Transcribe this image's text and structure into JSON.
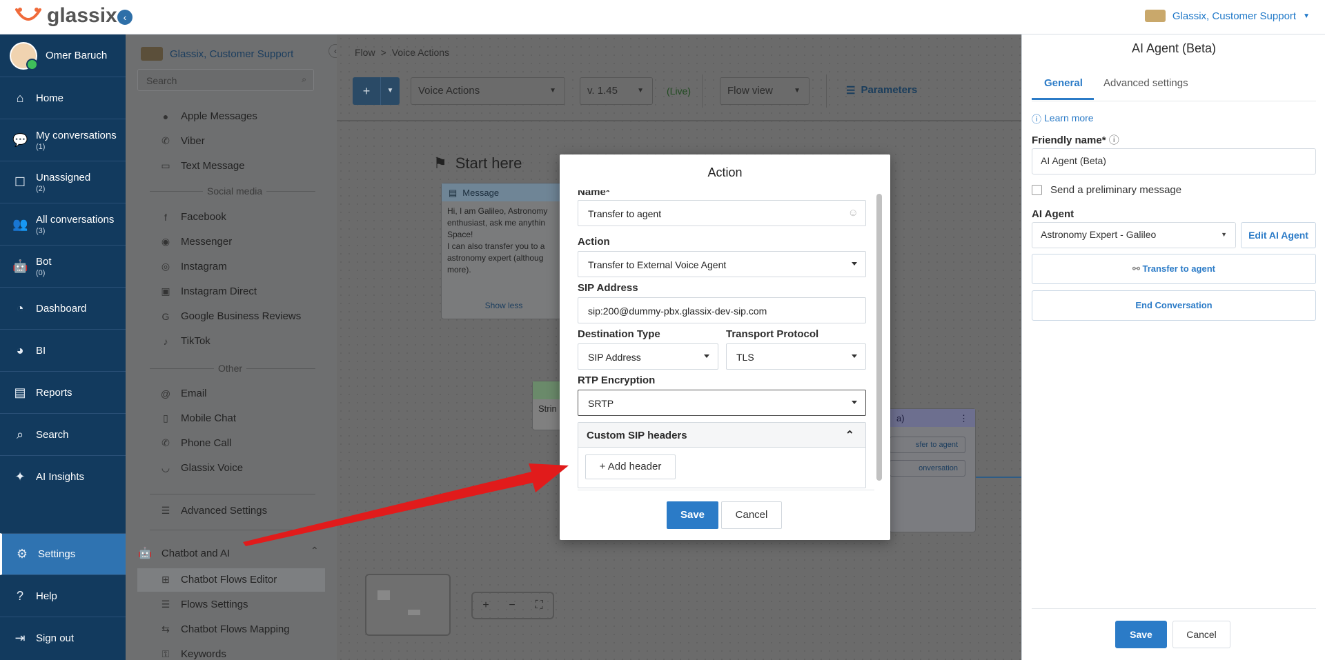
{
  "app": {
    "logo_text": "glassix"
  },
  "topbar": {
    "account_name": "Glassix, Customer Support"
  },
  "nav": {
    "user_name": "Omer Baruch",
    "items": [
      {
        "label": "Home",
        "count": ""
      },
      {
        "label": "My conversations",
        "count": "(1)"
      },
      {
        "label": "Unassigned",
        "count": "(2)"
      },
      {
        "label": "All conversations",
        "count": "(3)"
      },
      {
        "label": "Bot",
        "count": "(0)"
      },
      {
        "label": "Dashboard",
        "count": ""
      },
      {
        "label": "BI",
        "count": ""
      },
      {
        "label": "Reports",
        "count": ""
      },
      {
        "label": "Search",
        "count": ""
      },
      {
        "label": "AI Insights",
        "count": ""
      },
      {
        "label": "Settings",
        "count": ""
      },
      {
        "label": "Help",
        "count": ""
      },
      {
        "label": "Sign out",
        "count": ""
      }
    ]
  },
  "settings_sidebar": {
    "org_name": "Glassix, Customer Support",
    "search_placeholder": "Search",
    "channels_top": [
      "Apple Messages",
      "Viber",
      "Text Message"
    ],
    "social_heading": "Social media",
    "social": [
      "Facebook",
      "Messenger",
      "Instagram",
      "Instagram Direct",
      "Google Business Reviews",
      "TikTok"
    ],
    "other_heading": "Other",
    "other": [
      "Email",
      "Mobile Chat",
      "Phone Call",
      "Glassix Voice"
    ],
    "advanced": "Advanced Settings",
    "chatbot_section": "Chatbot and AI",
    "chatbot_items": [
      "Chatbot Flows Editor",
      "Flows Settings",
      "Chatbot Flows Mapping",
      "Keywords"
    ]
  },
  "canvas": {
    "breadcrumb_root": "Flow",
    "breadcrumb_sep": ">",
    "breadcrumb_current": "Voice Actions",
    "add_label": "+",
    "flow_select": "Voice Actions",
    "version_select": "v. 1.45",
    "live_label": "(Live)",
    "view_select": "Flow view",
    "parameters_label": "Parameters",
    "start_label": "Start here",
    "message_card_title": "Message",
    "message_text_1": "Hi, I am Galileo, Astronomy",
    "message_text_2": "enthusiast, ask me anythin",
    "message_text_3": "Space!",
    "message_text_4": "I can also transfer you to a",
    "message_text_5": "astronomy expert (althoug",
    "message_text_6": "more).",
    "show_less": "Show less",
    "partial_card_text": "Strin",
    "right_card_header": "a)",
    "right_card_btn1": "sfer to agent",
    "right_card_btn2": "onversation",
    "zoom_in": "+",
    "zoom_out": "−",
    "fit": "⛶"
  },
  "right_panel": {
    "title": "AI Agent (Beta)",
    "tab_general": "General",
    "tab_advanced": "Advanced settings",
    "learn_more": "Learn more",
    "friendly_name_label": "Friendly name*",
    "friendly_name_value": "AI Agent (Beta)",
    "preliminary_label": "Send a preliminary message",
    "ai_agent_label": "AI Agent",
    "ai_agent_value": "Astronomy Expert - Galileo",
    "edit_agent": "Edit AI Agent",
    "transfer_btn": "Transfer to agent",
    "end_btn": "End Conversation",
    "save": "Save",
    "cancel": "Cancel"
  },
  "modal": {
    "title": "Action",
    "name_label": "Name*",
    "name_value": "Transfer to agent",
    "action_label": "Action",
    "action_value": "Transfer to External Voice Agent",
    "sip_label": "SIP Address",
    "sip_value": "sip:200@dummy-pbx.glassix-dev-sip.com",
    "dest_label": "Destination Type",
    "dest_value": "SIP Address",
    "transport_label": "Transport Protocol",
    "transport_value": "TLS",
    "rtp_label": "RTP Encryption",
    "rtp_value": "SRTP",
    "custom_headers_label": "Custom SIP headers",
    "add_header": "+ Add header",
    "save": "Save",
    "cancel": "Cancel"
  },
  "colors": {
    "nav_bg": "#123a5e",
    "accent": "#2b7bc7",
    "arrow": "#e11b1b"
  }
}
